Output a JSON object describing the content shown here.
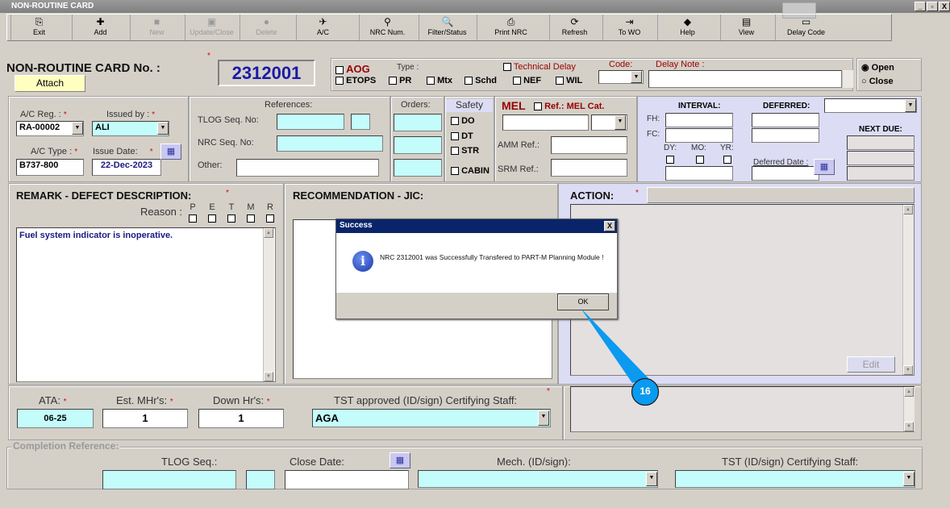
{
  "window": {
    "title": "NON-ROUTINE CARD",
    "min": "_",
    "max": "▫",
    "close": "X"
  },
  "toolbar": [
    {
      "label": "Exit",
      "icon": "exit-icon",
      "glyph": "⎘",
      "enabled": true
    },
    {
      "label": "Add",
      "icon": "add-icon",
      "glyph": "✚",
      "enabled": true
    },
    {
      "label": "New",
      "icon": "new-icon",
      "glyph": "■",
      "enabled": false
    },
    {
      "label": "Update/Close",
      "icon": "save-icon",
      "glyph": "▣",
      "enabled": false
    },
    {
      "label": "Delete",
      "icon": "delete-icon",
      "glyph": "●",
      "enabled": false
    },
    {
      "label": "A/C",
      "icon": "aircraft-icon",
      "glyph": "✈",
      "enabled": true
    },
    {
      "label": "NRC Num.",
      "icon": "search-people-icon",
      "glyph": "⚲",
      "enabled": true
    },
    {
      "label": "Filter/Status",
      "icon": "magnifier-icon",
      "glyph": "🔍",
      "enabled": true
    },
    {
      "label": "Print NRC",
      "icon": "printer-icon",
      "glyph": "⎙",
      "enabled": true
    },
    {
      "label": "Refresh",
      "icon": "refresh-icon",
      "glyph": "⟳",
      "enabled": true
    },
    {
      "label": "To WO",
      "icon": "to-wo-icon",
      "glyph": "⇥",
      "enabled": true
    },
    {
      "label": "Help",
      "icon": "help-book-icon",
      "glyph": "◆",
      "enabled": true
    },
    {
      "label": "View",
      "icon": "view-icon",
      "glyph": "▤",
      "enabled": true
    },
    {
      "label": "Delay Code",
      "icon": "delay-code-icon",
      "glyph": "▭",
      "enabled": true
    }
  ],
  "header": {
    "title": "NON-ROUTINE CARD No. :",
    "attach": "Attach",
    "card_no": "2312001",
    "required": "*"
  },
  "type_group": {
    "aog": "AOG",
    "type_label": "Type :",
    "etops": "ETOPS",
    "pr": "PR",
    "mtx": "Mtx",
    "schd": "Schd",
    "nef": "NEF",
    "wil": "WIL",
    "technical_delay": "Technical Delay",
    "code_label": "Code:",
    "delay_note_label": "Delay Note :",
    "delay_note": ""
  },
  "status": {
    "open": "Open",
    "close": "Close",
    "selected": "Open"
  },
  "aircraft": {
    "reg_label": "A/C Reg. :",
    "reg": "RA-00002",
    "issued_by_label": "Issued by :",
    "issued_by": "ALI",
    "type_label": "A/C Type :",
    "type": "B737-800",
    "issue_date_label": "Issue Date:",
    "issue_date": "22-Dec-2023"
  },
  "references": {
    "title": "References:",
    "tlog": "TLOG Seq. No:",
    "nrc": "NRC Seq. No:",
    "other": "Other:",
    "orders": "Orders:"
  },
  "safety": {
    "title": "Safety",
    "do": "DO",
    "dt": "DT",
    "str": "STR",
    "cabin": "CABIN"
  },
  "mel": {
    "title": "MEL",
    "ref": "Ref.: MEL Cat.",
    "amm": "AMM Ref.:",
    "srm": "SRM Ref.:"
  },
  "interval": {
    "interval": "INTERVAL:",
    "deferred": "DEFERRED:",
    "fh": "FH:",
    "fc": "FC:",
    "dy": "DY:",
    "mo": "MO:",
    "yr": "YR:",
    "deferred_date": "Deferred Date :",
    "next_due": "NEXT DUE:"
  },
  "remark": {
    "title": "REMARK - DEFECT DESCRIPTION:",
    "reason": "Reason :",
    "reasons": [
      "P",
      "E",
      "T",
      "M",
      "R"
    ],
    "text": "Fuel system indicator is inoperative."
  },
  "recommendation": {
    "title": "RECOMMENDATION - JIC:"
  },
  "action": {
    "title": "ACTION:",
    "edit": "Edit"
  },
  "hours": {
    "ata_label": "ATA:",
    "ata": "06-25",
    "mhr_label": "Est. MHr's:",
    "mhr": "1",
    "down_label": "Down Hr's:",
    "down": "1",
    "tst_label": "TST approved (ID/sign) Certifying Staff:",
    "tst": "AGA"
  },
  "completion": {
    "title": "Completion Reference:",
    "tlog": "TLOG Seq.:",
    "close_date": "Close Date:",
    "mech": "Mech. (ID/sign):",
    "tst": "TST (ID/sign) Certifying Staff:"
  },
  "dialog": {
    "title": "Success",
    "message": "NRC 2312001 was Successfully Transfered to PART-M Planning Module !",
    "ok": "OK",
    "close": "X"
  },
  "callout": {
    "number": "16",
    "color": "#0a9af0"
  }
}
